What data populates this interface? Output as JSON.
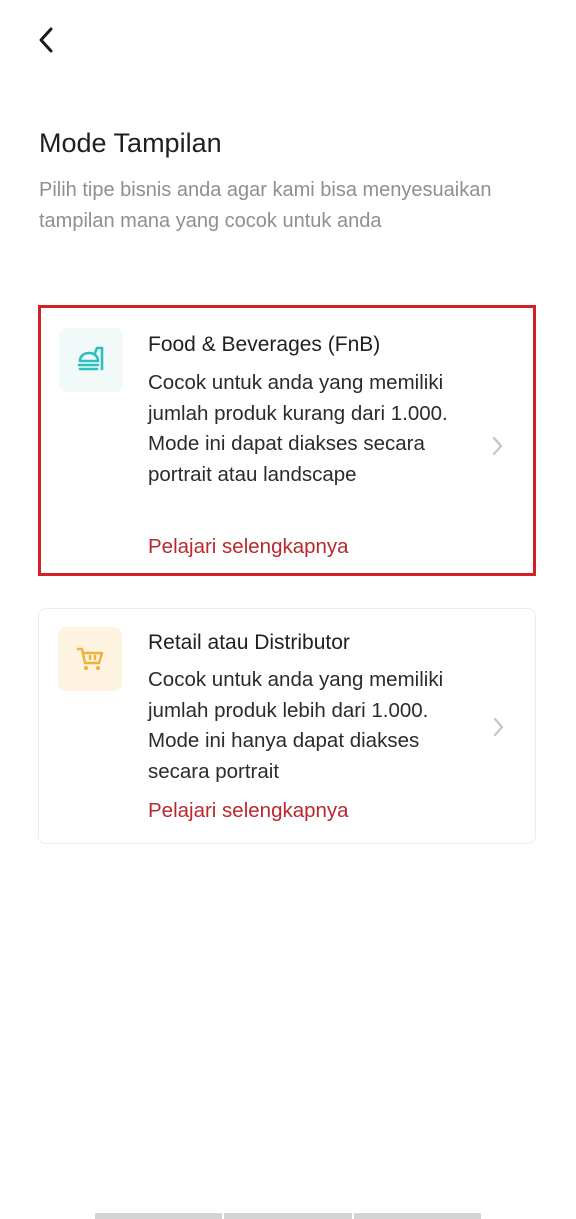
{
  "header": {
    "back_icon": "chevron-left-icon"
  },
  "page": {
    "title": "Mode Tampilan",
    "subtitle": "Pilih tipe bisnis anda agar kami bisa menyesuaikan tampilan mana yang cocok untuk anda"
  },
  "modes": [
    {
      "icon": "food-delivery-icon",
      "icon_color": "#2bbfbf",
      "title": "Food & Beverages (FnB)",
      "description": "Cocok untuk anda yang memiliki jumlah produk kurang dari 1.000. Mode ini dapat diakses secara portrait atau landscape",
      "link": "Pelajari selengkapnya",
      "selected": true
    },
    {
      "icon": "shopping-cart-icon",
      "icon_color": "#f2b035",
      "title": "Retail atau Distributor",
      "description": "Cocok untuk anda yang memiliki jumlah produk lebih dari 1.000. Mode ini hanya dapat diakses secara portrait",
      "link": "Pelajari selengkapnya",
      "selected": false
    }
  ],
  "colors": {
    "accent": "#b8282e",
    "selected_border": "#d32027"
  }
}
